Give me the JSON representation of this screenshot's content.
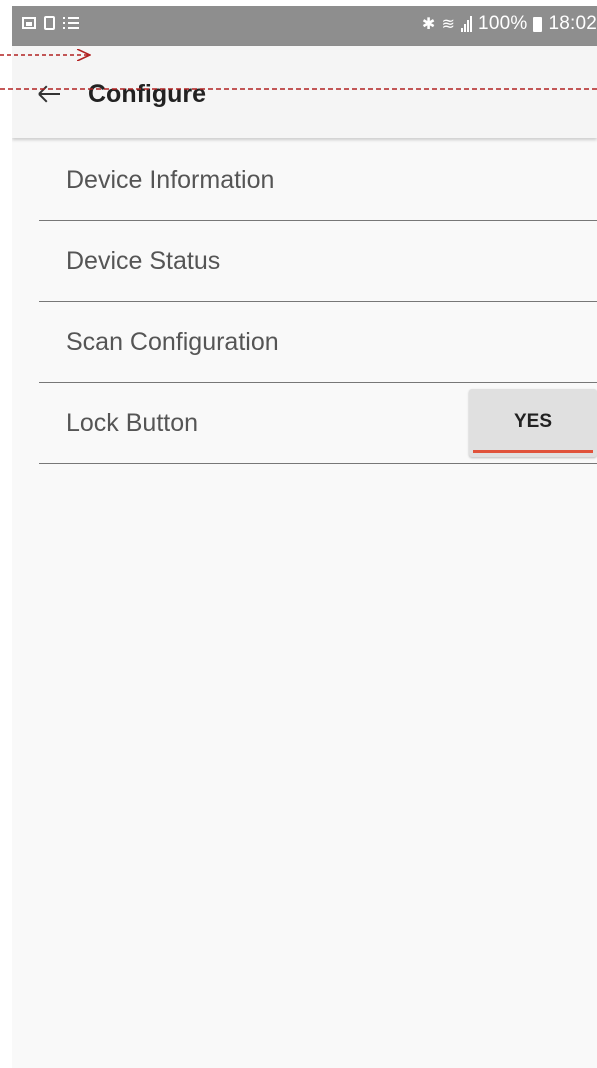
{
  "statusbar": {
    "left_icons": [
      "image-icon",
      "document-icon",
      "list-icon"
    ],
    "bluetooth_icon": "bluetooth-icon",
    "wifi_icon": "wifi-icon",
    "signal_icon": "signal-icon",
    "battery_level": "100%",
    "battery_icon": "battery-icon",
    "time": "18:02"
  },
  "appbar": {
    "back_icon": "arrow-left-icon",
    "title": "Configure"
  },
  "menu": {
    "items": [
      {
        "label": "Device Information"
      },
      {
        "label": "Device Status"
      },
      {
        "label": "Scan Configuration"
      },
      {
        "label": "Lock Button",
        "toggle": "YES"
      }
    ]
  },
  "colors": {
    "screen_bg": "#f9f9f9",
    "statusbar_bg": "#8e8e8e",
    "appbar_bg": "#f5f5f5",
    "toggle_bg": "#e0e0e0",
    "toggle_accent": "#e0523a",
    "annotation_arrow": "#b22222"
  }
}
